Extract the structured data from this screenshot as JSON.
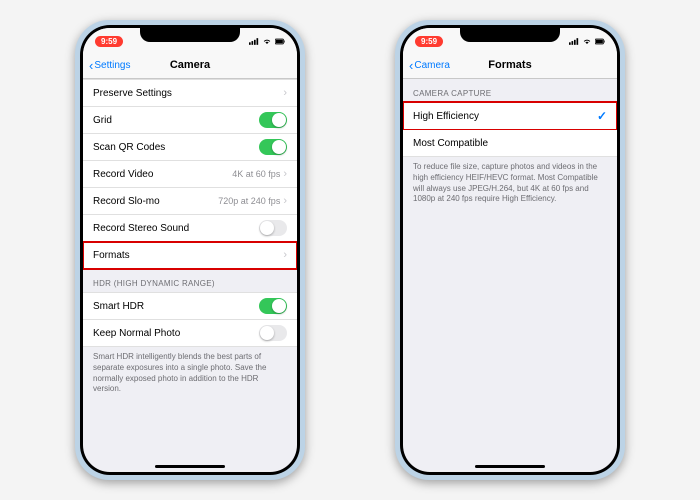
{
  "status": {
    "time": "9:59"
  },
  "left": {
    "back": "Settings",
    "title": "Camera",
    "rows": {
      "preserve": "Preserve Settings",
      "grid": "Grid",
      "qr": "Scan QR Codes",
      "video": "Record Video",
      "video_v": "4K at 60 fps",
      "slomo": "Record Slo-mo",
      "slomo_v": "720p at 240 fps",
      "stereo": "Record Stereo Sound",
      "formats": "Formats"
    },
    "hdr_hdr": "HDR (HIGH DYNAMIC RANGE)",
    "hdr": {
      "smart": "Smart HDR",
      "keep": "Keep Normal Photo"
    },
    "hdr_foot": "Smart HDR intelligently blends the best parts of separate exposures into a single photo. Save the normally exposed photo in addition to the HDR version."
  },
  "right": {
    "back": "Camera",
    "title": "Formats",
    "section": "CAMERA CAPTURE",
    "opt1": "High Efficiency",
    "opt2": "Most Compatible",
    "foot": "To reduce file size, capture photos and videos in the high efficiency HEIF/HEVC format. Most Compatible will always use JPEG/H.264, but 4K at 60 fps and 1080p at 240 fps require High Efficiency."
  }
}
